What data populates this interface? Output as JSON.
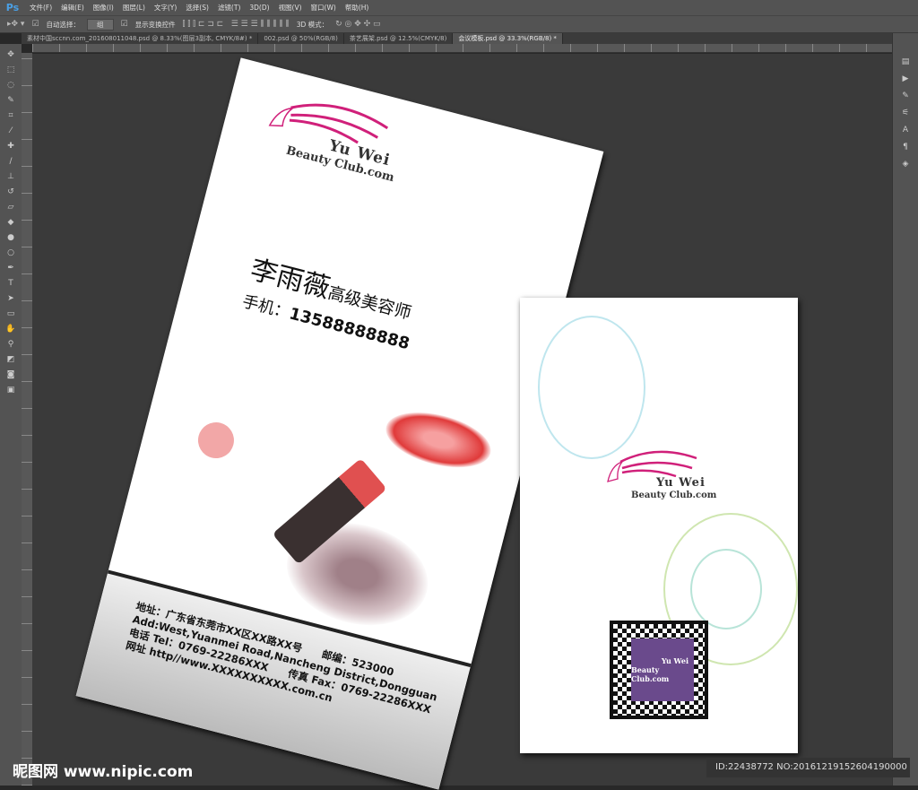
{
  "app": {
    "logo": "Ps",
    "menus": [
      "文件(F)",
      "编辑(E)",
      "图像(I)",
      "图层(L)",
      "文字(Y)",
      "选择(S)",
      "滤镜(T)",
      "3D(D)",
      "视图(V)",
      "窗口(W)",
      "帮助(H)"
    ]
  },
  "options": {
    "auto_select_label": "自动选择：",
    "auto_select_value": "组",
    "show_transform_label": "显示变换控件",
    "mode_3d_label": "3D 模式："
  },
  "tabs": [
    "素材中国sccnn.com_201608011048.psd @ 8.33%(图层3副本, CMYK/8#) *",
    "002.psd @ 50%(RGB/8)",
    "茶艺展架.psd @ 12.5%(CMYK/8)",
    "会议模板.psd @ 33.3%(RGB/8) *"
  ],
  "card_front": {
    "logo_line1": "Yu Wei",
    "logo_line2": "Beauty Club.com",
    "name": "李雨薇",
    "title": "高级美容师",
    "phone_label": "手机：",
    "phone": "13588888888",
    "address": "地址：广东省东莞市XX区XX路XX号　　邮编：523000",
    "address_en": "Add:West,Yuanmei Road,Nancheng District,Dongguan",
    "tel": "电话 Tel：0769-22286XXX　　传真 Fax：0769-22286XXX",
    "web": "网址 http//www.XXXXXXXXXX.com.cn"
  },
  "card_back": {
    "logo_line1": "Yu Wei",
    "logo_line2": "Beauty Club.com",
    "qr_line1": "Yu Wei",
    "qr_line2": "Beauty Club.com"
  },
  "watermark": "昵图网 www.nipic.com",
  "image_id": "ID:22438772 NO:20161219152604190000"
}
